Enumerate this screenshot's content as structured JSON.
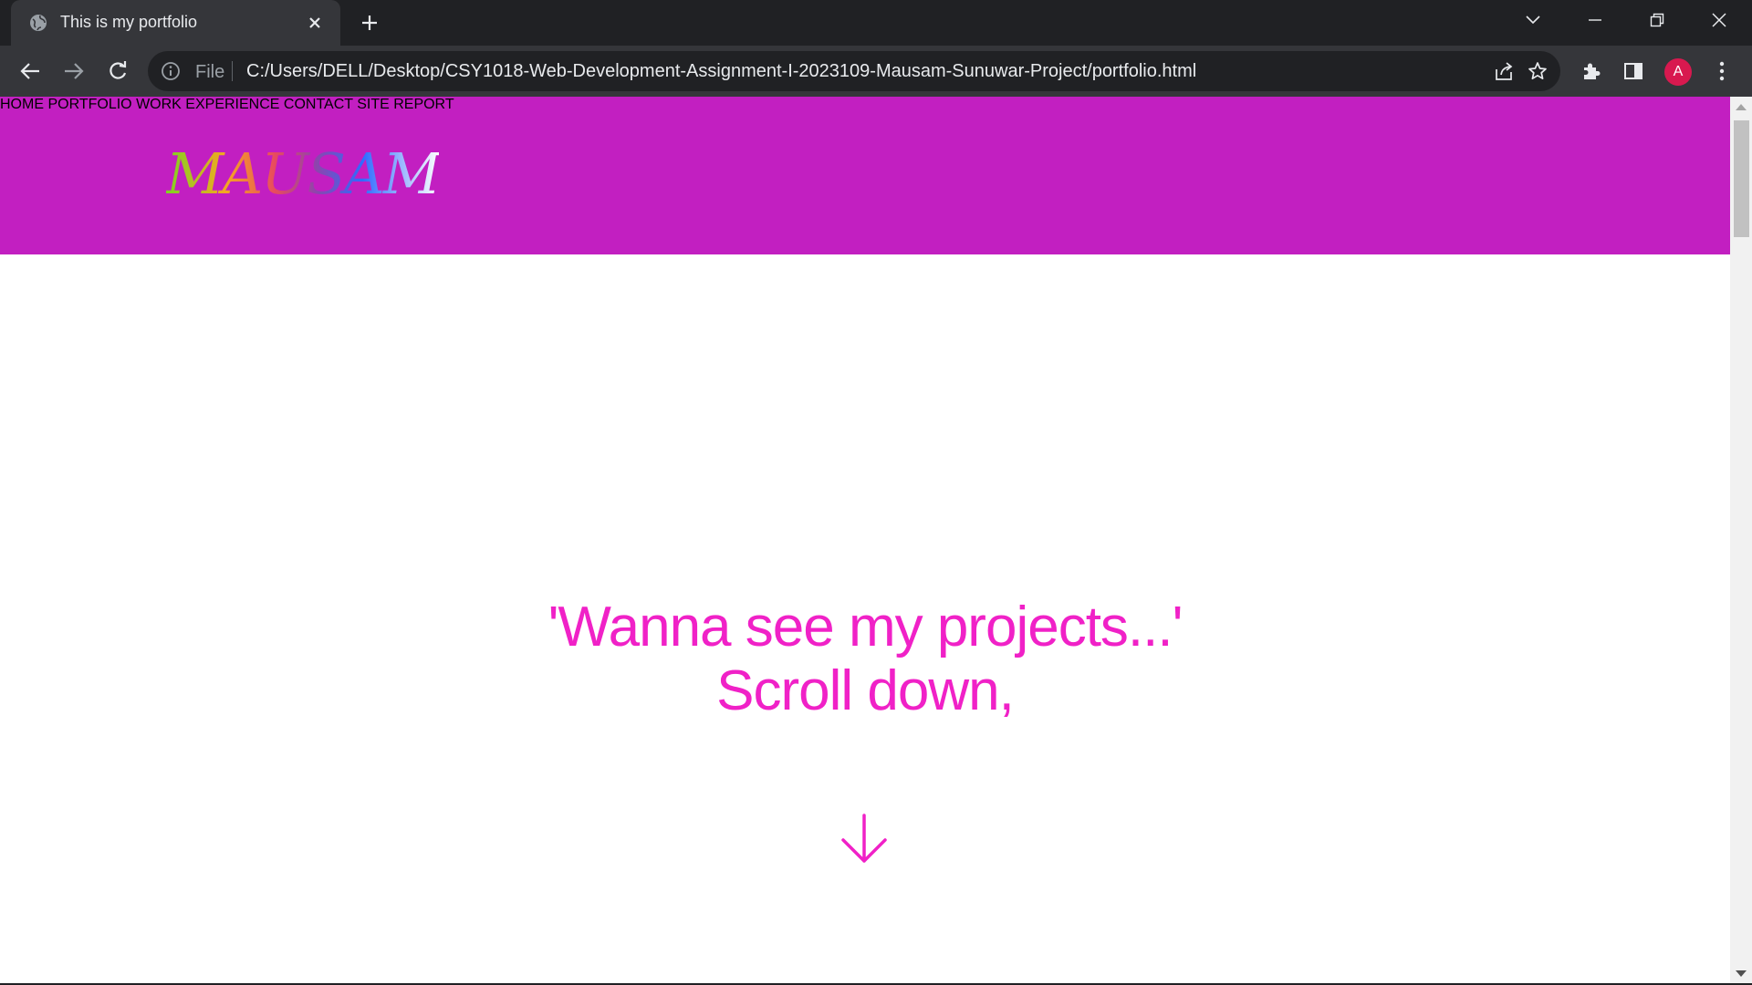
{
  "browser": {
    "tab_title": "This is my portfolio",
    "omnibox_scheme_label": "File",
    "url": "C:/Users/DELL/Desktop/CSY1018-Web-Development-Assignment-I-2023109-Mausam-Sunuwar-Project/portfolio.html",
    "profile_initial": "A",
    "icons": [
      "globe-icon",
      "close-icon",
      "plus-icon",
      "chevron-down-icon",
      "minimize-icon",
      "restore-icon",
      "window-close-icon",
      "back-arrow-icon",
      "forward-arrow-icon",
      "reload-icon",
      "info-icon",
      "share-icon",
      "star-icon",
      "puzzle-icon",
      "side-panel-icon",
      "kebab-menu-icon"
    ]
  },
  "site": {
    "logo": "MAUSAM",
    "nav": [
      {
        "label": "HOME"
      },
      {
        "label": "PORTFOLIO"
      },
      {
        "label": "WORK EXPERIENCE"
      },
      {
        "label": "CONTACT"
      },
      {
        "label": "SITE REPORT"
      }
    ],
    "headline_line1": "'Wanna see my projects...'",
    "headline_line2": "Scroll down,",
    "scroll_icon": "arrow-down-icon"
  },
  "colors": {
    "header_bg": "#c21fc1",
    "nav_text": "#ffc7ef",
    "headline": "#f021c7",
    "avatar": "#d8194f"
  }
}
